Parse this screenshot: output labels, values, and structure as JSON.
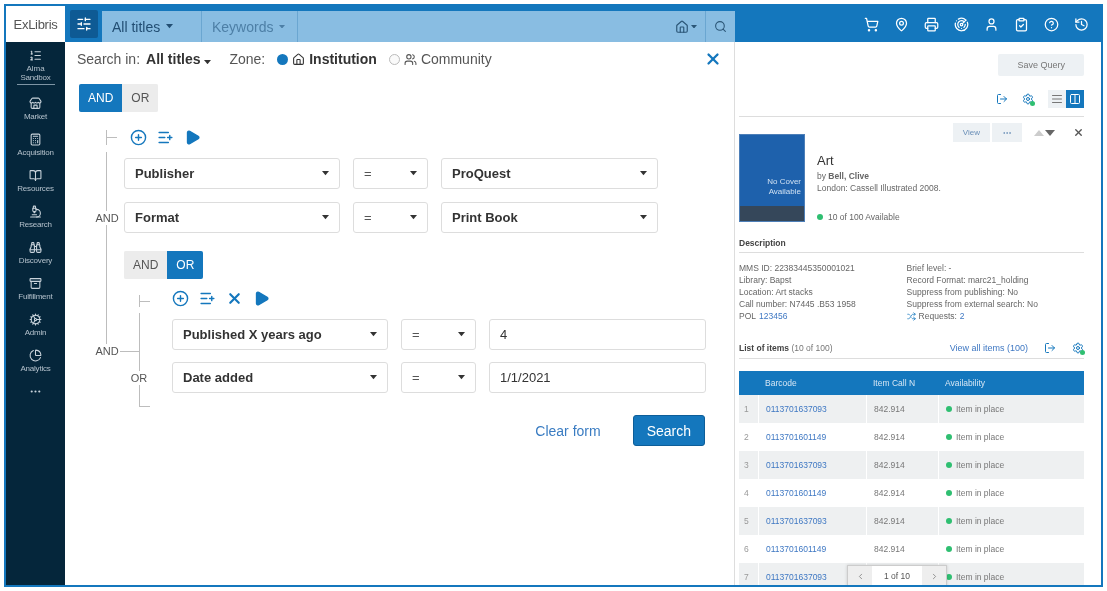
{
  "sidebar": {
    "logo": "ExLibris",
    "workspace": {
      "label": "Alma",
      "sublabel": "Sandbox"
    },
    "items": [
      {
        "label": "Market"
      },
      {
        "label": "Acquisition"
      },
      {
        "label": "Resources"
      },
      {
        "label": "Research"
      },
      {
        "label": "Discovery"
      },
      {
        "label": "Fulfillment"
      },
      {
        "label": "Admin"
      },
      {
        "label": "Analytics"
      }
    ]
  },
  "search_bar": {
    "scope": "All titles",
    "field": "Keywords"
  },
  "search_panel": {
    "search_in_label": "Search in:",
    "search_in_value": "All titles",
    "zone_label": "Zone:",
    "zones": [
      {
        "label": "Institution",
        "selected": true
      },
      {
        "label": "Community",
        "selected": false
      }
    ],
    "operators": [
      {
        "label": "AND",
        "selected": true
      },
      {
        "label": "OR",
        "selected": false
      }
    ],
    "group": {
      "join_label": "AND",
      "conditions": [
        {
          "field": "Publisher",
          "operator": "=",
          "value": "ProQuest",
          "kind": "select"
        },
        {
          "field": "Format",
          "operator": "=",
          "value": "Print Book",
          "kind": "select"
        }
      ],
      "subgroup": {
        "outer_join_label": "AND",
        "join_label": "OR",
        "operators": [
          {
            "label": "AND",
            "selected": false
          },
          {
            "label": "OR",
            "selected": true
          }
        ],
        "conditions": [
          {
            "field": "Published X years ago",
            "operator": "=",
            "value": "4",
            "kind": "input"
          },
          {
            "field": "Date added",
            "operator": "=",
            "value": "1/1/2021",
            "kind": "input"
          }
        ]
      }
    },
    "clear_label": "Clear form",
    "search_label": "Search"
  },
  "results": {
    "save_query": "Save Query",
    "view_modes": [
      {
        "selected": false
      },
      {
        "selected": true
      }
    ],
    "record": {
      "view_label": "View",
      "cover_text": "No Cover Available",
      "title": "Art",
      "author": "by **Bell, Clive**",
      "imprint": "London: Cassell Illustrated 2008.",
      "availability": "10 of 100 Available"
    },
    "description": {
      "heading": "Description",
      "left": [
        "MMS ID: 22383445350001021",
        "Library: Bapst",
        "Location: Art stacks",
        "Call number: N7445 .B53 1958"
      ],
      "pol_label": "POL",
      "pol_link": "123456",
      "right": [
        "Brief level: -",
        "Record Format: marc21_holding",
        "Suppress from publishing: No",
        "Suppress from external search: No"
      ],
      "requests_label": "Requests:",
      "requests_link": "2"
    },
    "items": {
      "heading": "List of items",
      "count": "(10 of 100)",
      "view_all": "View all items (100)",
      "columns": [
        "Barcode",
        "Item Call N",
        "Availability"
      ],
      "rows": [
        {
          "index": "1",
          "barcode": "0113701637093",
          "call_number": "842.914",
          "availability": "Item in place"
        },
        {
          "index": "2",
          "barcode": "0113701601149",
          "call_number": "842.914",
          "availability": "Item in place"
        },
        {
          "index": "3",
          "barcode": "0113701637093",
          "call_number": "842.914",
          "availability": "Item in place"
        },
        {
          "index": "4",
          "barcode": "0113701601149",
          "call_number": "842.914",
          "availability": "Item in place"
        },
        {
          "index": "5",
          "barcode": "0113701637093",
          "call_number": "842.914",
          "availability": "Item in place"
        },
        {
          "index": "6",
          "barcode": "0113701601149",
          "call_number": "842.914",
          "availability": "Item in place"
        },
        {
          "index": "7",
          "barcode": "0113701637093",
          "availability": "Item in place"
        }
      ],
      "pager": "1 of 10"
    }
  }
}
